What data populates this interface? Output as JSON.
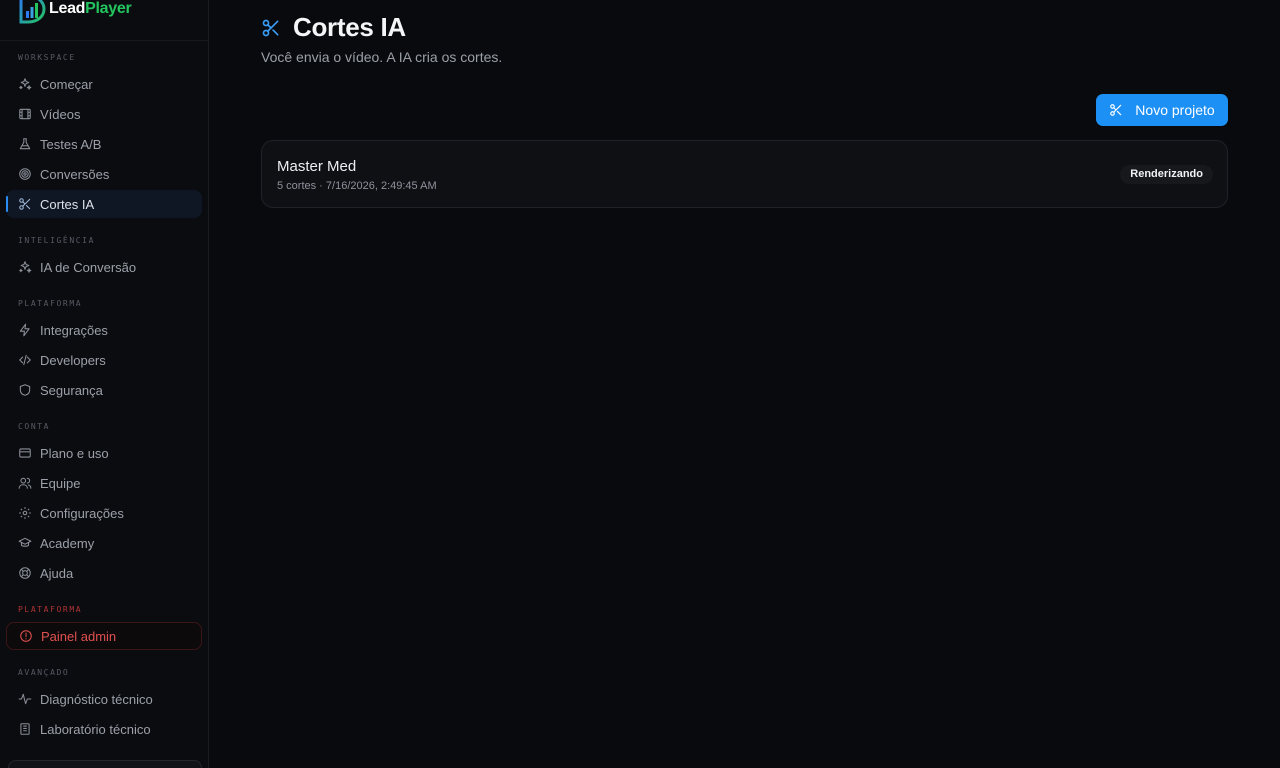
{
  "brand": {
    "lead": "Lead",
    "player": "Player"
  },
  "sidebar": {
    "sections": [
      {
        "label": "WORKSPACE",
        "items": [
          {
            "label": "Começar",
            "icon": "sparkles-icon"
          },
          {
            "label": "Vídeos",
            "icon": "film-icon"
          },
          {
            "label": "Testes A/B",
            "icon": "flask-icon"
          },
          {
            "label": "Conversões",
            "icon": "target-icon"
          },
          {
            "label": "Cortes IA",
            "icon": "scissors-icon",
            "active": true
          }
        ]
      },
      {
        "label": "INTELIGÊNCIA",
        "items": [
          {
            "label": "IA de Conversão",
            "icon": "sparkles-icon"
          }
        ]
      },
      {
        "label": "PLATAFORMA",
        "items": [
          {
            "label": "Integrações",
            "icon": "bolt-icon"
          },
          {
            "label": "Developers",
            "icon": "code-icon"
          },
          {
            "label": "Segurança",
            "icon": "shield-icon"
          }
        ]
      },
      {
        "label": "CONTA",
        "items": [
          {
            "label": "Plano e uso",
            "icon": "credit-card-icon"
          },
          {
            "label": "Equipe",
            "icon": "users-icon"
          },
          {
            "label": "Configurações",
            "icon": "gear-icon"
          },
          {
            "label": "Academy",
            "icon": "graduation-cap-icon"
          },
          {
            "label": "Ajuda",
            "icon": "life-buoy-icon"
          }
        ]
      },
      {
        "label": "PLATAFORMA",
        "items": [
          {
            "label": "Painel admin",
            "icon": "shield-alert-icon"
          }
        ]
      },
      {
        "label": "AVANÇADO",
        "items": [
          {
            "label": "Diagnóstico técnico",
            "icon": "activity-icon"
          },
          {
            "label": "Laboratório técnico",
            "icon": "building-icon"
          }
        ]
      }
    ]
  },
  "header": {
    "title": "Cortes IA",
    "subtitle": "Você envia o vídeo. A IA cria os cortes.",
    "title_icon": "scissors-icon"
  },
  "toolbar": {
    "new_project_label": "Novo projeto"
  },
  "projects": [
    {
      "name": "Master Med",
      "meta": "5 cortes · 7/16/2026, 2:49:45 AM",
      "status": "Renderizando"
    }
  ],
  "colors": {
    "accent": "#1d90f5",
    "admin": "#e05050",
    "brand_green": "#22c55e"
  }
}
